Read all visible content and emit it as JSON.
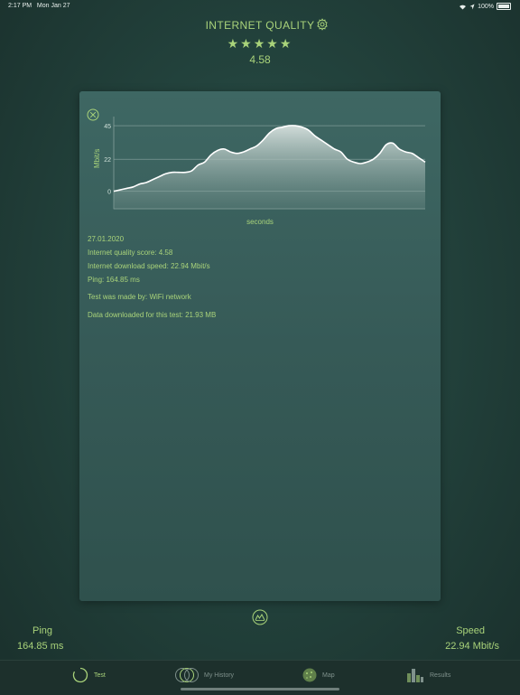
{
  "status_bar": {
    "time": "2:17 PM",
    "date": "Mon Jan 27",
    "battery": "100%"
  },
  "header": {
    "title": "INTERNET QUALITY",
    "stars": "★★★★★",
    "score": "4.58"
  },
  "chart_data": {
    "type": "area",
    "xlabel": "seconds",
    "ylabel": "Mbit/s",
    "yticks": [
      0,
      22,
      45
    ],
    "ylim": [
      -12,
      50
    ],
    "grid": true,
    "values": [
      0,
      1,
      2,
      3,
      5,
      6,
      8,
      10,
      12,
      13,
      13,
      13,
      14,
      18,
      20,
      25,
      28,
      29,
      27,
      26,
      27,
      29,
      31,
      35,
      40,
      43,
      44,
      45,
      45,
      44,
      42,
      38,
      35,
      32,
      29,
      27,
      22,
      20,
      19,
      20,
      22,
      26,
      32,
      33,
      29,
      27,
      26,
      23,
      20
    ]
  },
  "details": {
    "date": "27.01.2020",
    "quality_score": "Internet quality score:  4.58",
    "download_speed": "Internet download speed:  22.94 Mbit/s",
    "ping": "Ping:  164.85 ms",
    "test_made_by": "Test was made by:  WiFi network",
    "data_downloaded": "Data downloaded for this test:  21.93 MB"
  },
  "stats": {
    "ping_label": "Ping",
    "ping_value": "164.85 ms",
    "speed_label": "Speed",
    "speed_value": "22.94 Mbit/s"
  },
  "tabs": [
    {
      "label": "Test",
      "icon": "test-spinner-icon",
      "active": true
    },
    {
      "label": "My History",
      "icon": "history-circles-icon",
      "active": false
    },
    {
      "label": "Map",
      "icon": "map-globe-icon",
      "active": false
    },
    {
      "label": "Results",
      "icon": "results-bars-icon",
      "active": false
    }
  ],
  "colors": {
    "accent": "#a9d37a",
    "tab_inactive": "#7f918c",
    "card": "#3a605c",
    "background": "#23433d"
  }
}
